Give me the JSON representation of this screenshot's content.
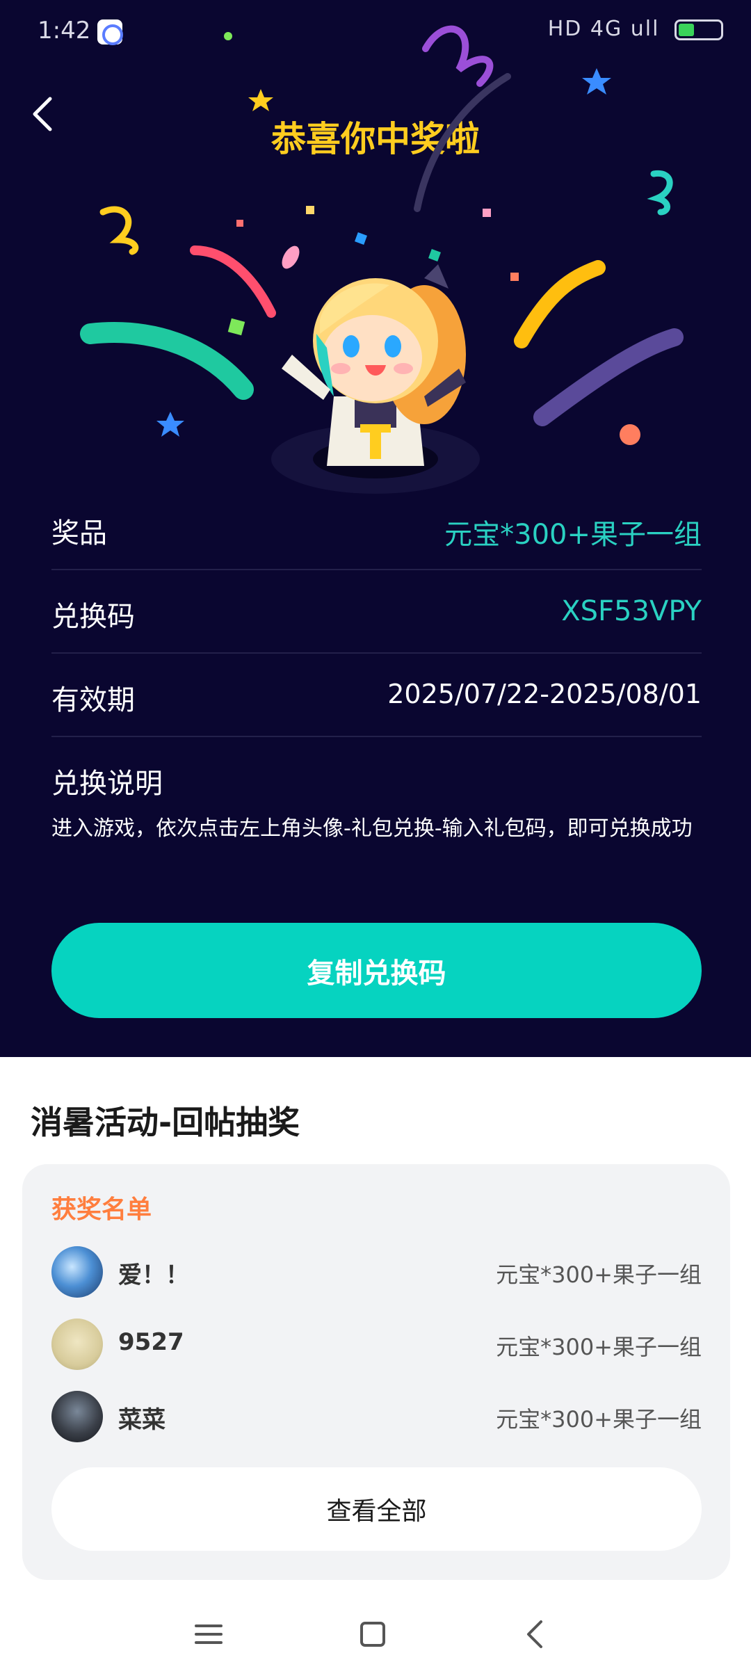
{
  "status_bar": {
    "time": "1:42",
    "right_text": "HD 4G ull"
  },
  "header": {
    "title": "恭喜你中奖啦"
  },
  "prize_info": {
    "prize_label": "奖品",
    "prize_value": "元宝*300+果子一组",
    "code_label": "兑换码",
    "code_value": "XSF53VPY",
    "validity_label": "有效期",
    "validity_value": "2025/07/22-2025/08/01",
    "instructions_label": "兑换说明",
    "instructions_text": "进入游戏，依次点击左上角头像-礼包兑换-输入礼包码，即可兑换成功"
  },
  "copy_button": {
    "label": "复制兑换码"
  },
  "activity": {
    "title": "消暑活动-回帖抽奖",
    "winners_title": "获奖名单",
    "winners": [
      {
        "name": "爱！！",
        "prize": "元宝*300+果子一组"
      },
      {
        "name": "9527",
        "prize": "元宝*300+果子一组"
      },
      {
        "name": "菜菜",
        "prize": "元宝*300+果子一组"
      }
    ],
    "view_all_label": "查看全部"
  },
  "colors": {
    "hero_background": "#0a0630",
    "accent_teal": "#06d3c0",
    "title_yellow": "#ffcd1f",
    "winners_orange": "#ff7e3e"
  },
  "icons": {
    "back": "chevron-left-icon",
    "nav_menu": "menu-icon",
    "nav_home": "square-home-icon",
    "nav_back": "chevron-back-icon"
  }
}
